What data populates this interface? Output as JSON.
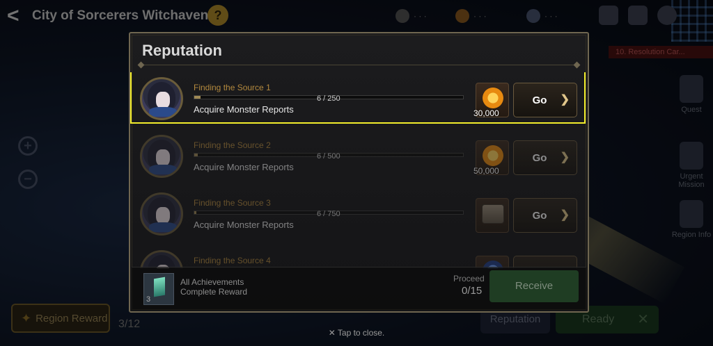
{
  "header": {
    "back_label": "<",
    "title": "City of Sorcerers Witchaven",
    "help": "?"
  },
  "side_menu": {
    "quest_banner": "10. Resolution Car...",
    "items": [
      {
        "label": "Quest"
      },
      {
        "label": "Urgent Mission"
      },
      {
        "label": "Region Info"
      }
    ]
  },
  "bottom_bar": {
    "region_reward": "Region Reward",
    "region_count": "3/12",
    "reputation": "Reputation",
    "ready": "Ready",
    "tap_close": "Tap to close."
  },
  "modal": {
    "title": "Reputation",
    "rows": [
      {
        "name": "Finding the Source 1",
        "progress_text": "6 / 250",
        "progress": 0.024,
        "desc": "Acquire Monster Reports",
        "reward_icon": "gold-coin-icon",
        "reward_amount": "30,000",
        "go": "Go",
        "selected": true
      },
      {
        "name": "Finding the Source 2",
        "progress_text": "6 / 500",
        "progress": 0.012,
        "desc": "Acquire Monster Reports",
        "reward_icon": "gold-coin-icon",
        "reward_amount": "50,000",
        "go": "Go",
        "selected": false
      },
      {
        "name": "Finding the Source 3",
        "progress_text": "6 / 750",
        "progress": 0.008,
        "desc": "Acquire Monster Reports",
        "reward_icon": "chest-icon",
        "reward_amount": "",
        "go": "Go",
        "selected": false
      },
      {
        "name": "Finding the Source 4",
        "progress_text": "",
        "progress": 0,
        "desc": "",
        "reward_icon": "gem-icon",
        "reward_amount": "",
        "go": "",
        "selected": false
      }
    ],
    "footer": {
      "gem_count": "3",
      "all_achievements": "All Achievements",
      "complete_reward": "Complete Reward",
      "proceed_label": "Proceed",
      "proceed_value": "0/15",
      "receive": "Receive"
    }
  },
  "colors": {
    "highlight": "#f3ee2c",
    "quest_name": "#b48a3e",
    "frame": "#6f6650"
  }
}
